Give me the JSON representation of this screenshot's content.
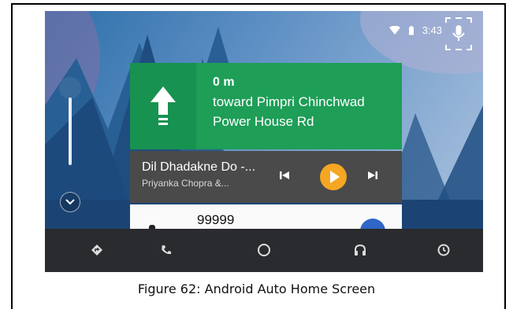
{
  "status_bar": {
    "time": "3:43",
    "icons": [
      "wifi-icon",
      "battery-icon",
      "microphone-icon"
    ]
  },
  "navigation_card": {
    "distance": "0 m",
    "direction_line1": "toward Pimpri Chinchwad",
    "direction_line2": "Power House Rd",
    "icon": "straight-arrow-icon",
    "color": "#1e9e57"
  },
  "media_card": {
    "title": "Dil Dhadakne Do -...",
    "artist": "Priyanka Chopra &...",
    "controls": [
      "skip-previous-icon",
      "play-icon",
      "skip-next-icon"
    ],
    "play_color": "#f5a623"
  },
  "call_card": {
    "number": "99999"
  },
  "bottom_nav": {
    "items": [
      "navigation-icon",
      "phone-icon",
      "home-icon",
      "headphones-icon",
      "recents-icon"
    ]
  },
  "caption": "Figure 62: Android Auto Home Screen"
}
